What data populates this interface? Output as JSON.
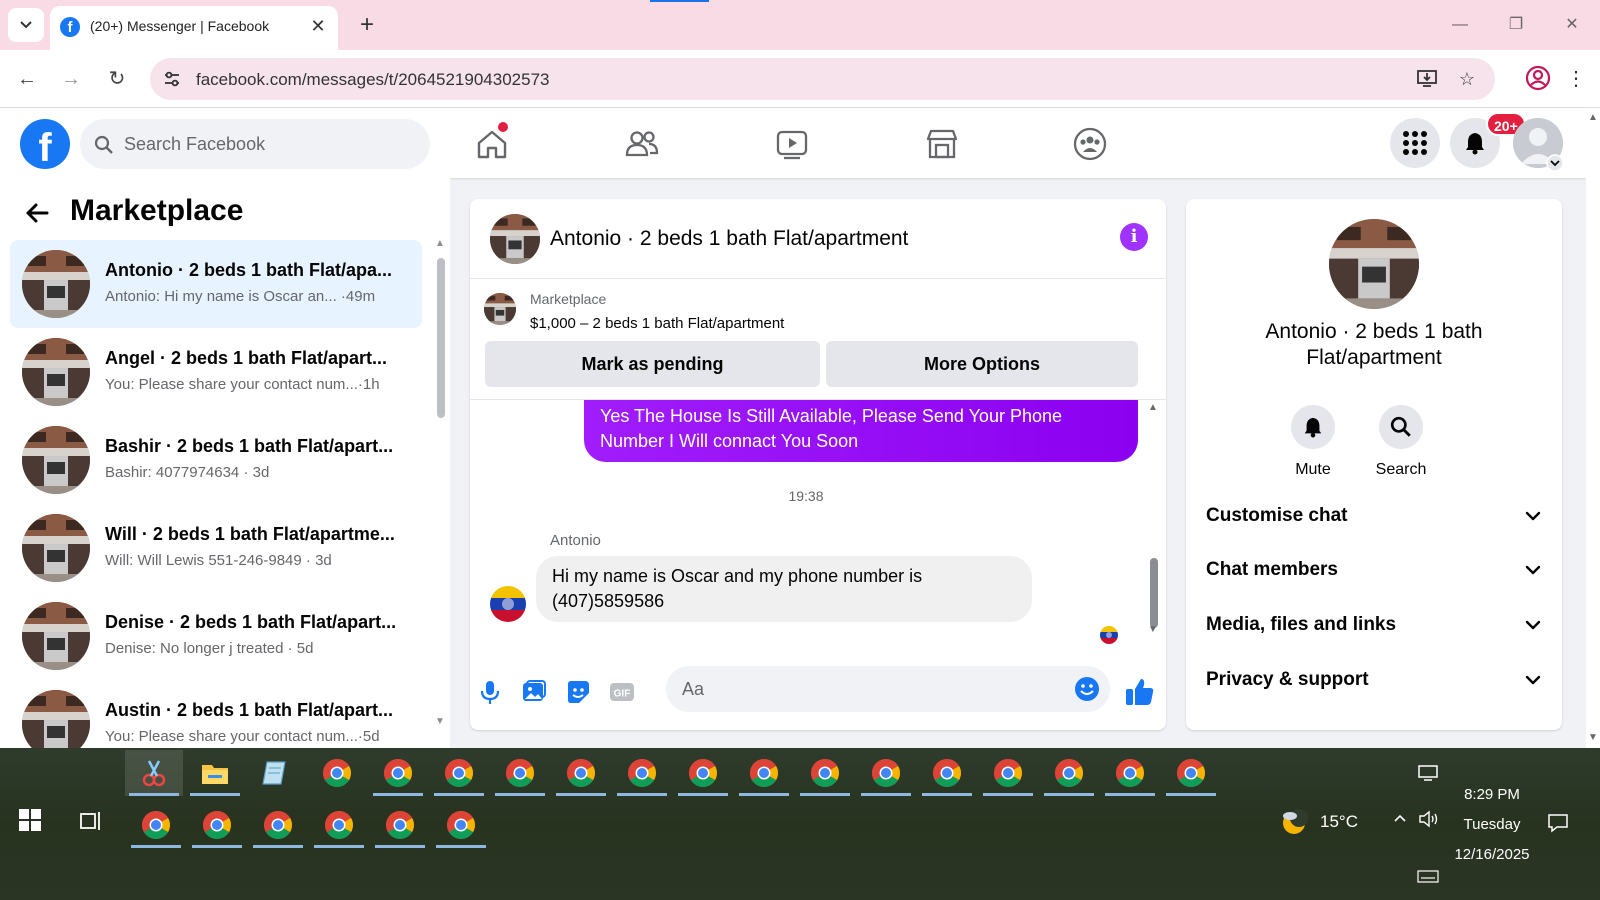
{
  "browser": {
    "tab_title": "(20+) Messenger | Facebook",
    "url": "facebook.com/messages/t/2064521904302573",
    "favicon_letter": "f"
  },
  "header": {
    "search_placeholder": "Search Facebook",
    "notification_badge": "20+",
    "home_has_dot": true
  },
  "left_panel": {
    "title": "Marketplace",
    "conversations": [
      {
        "name": "Antonio · 2 beds 1 bath Flat/apa...",
        "preview": "Antonio: Hi my name is Oscar an...  ·49m",
        "active": true
      },
      {
        "name": "Angel · 2 beds 1 bath Flat/apart...",
        "preview": "You: Please share your contact num...·1h",
        "active": false
      },
      {
        "name": "Bashir · 2 beds 1 bath Flat/apart...",
        "preview": "Bashir: 4077974634 · 3d",
        "active": false
      },
      {
        "name": "Will · 2 beds 1 bath Flat/apartme...",
        "preview": "Will: Will Lewis 551-246-9849 · 3d",
        "active": false
      },
      {
        "name": "Denise · 2 beds 1 bath Flat/apart...",
        "preview": "Denise: No longer j treated · 5d",
        "active": false
      },
      {
        "name": "Austin · 2 beds 1 bath Flat/apart...",
        "preview": "You: Please share your contact num...·5d",
        "active": false
      }
    ]
  },
  "chat": {
    "title": "Antonio · 2 beds 1 bath Flat/apartment",
    "marketplace_label": "Marketplace",
    "listing": "$1,000 – 2 beds 1 bath Flat/apartment",
    "mark_pending": "Mark as pending",
    "more_options": "More Options",
    "outgoing_message": "Yes The House Is Still Available, Please Send Your Phone Number I Will connact You Soon",
    "timestamp": "19:38",
    "sender": "Antonio",
    "incoming_message": "Hi my name is Oscar and my phone number is (407)5859586",
    "composer_placeholder": "Aa"
  },
  "right_panel": {
    "name": "Antonio · 2 beds 1 bath Flat/apartment",
    "mute": "Mute",
    "search": "Search",
    "sections": [
      "Customise chat",
      "Chat members",
      "Media, files and links",
      "Privacy & support"
    ]
  },
  "taskbar": {
    "temperature": "15°C",
    "time": "8:29 PM",
    "day": "Tuesday",
    "date": "12/16/2025"
  },
  "colors": {
    "fb_blue": "#1877f2",
    "messenger_purple": "#a033ff",
    "active_conv_bg": "#e7f3ff",
    "badge_red": "#e41e3f"
  }
}
